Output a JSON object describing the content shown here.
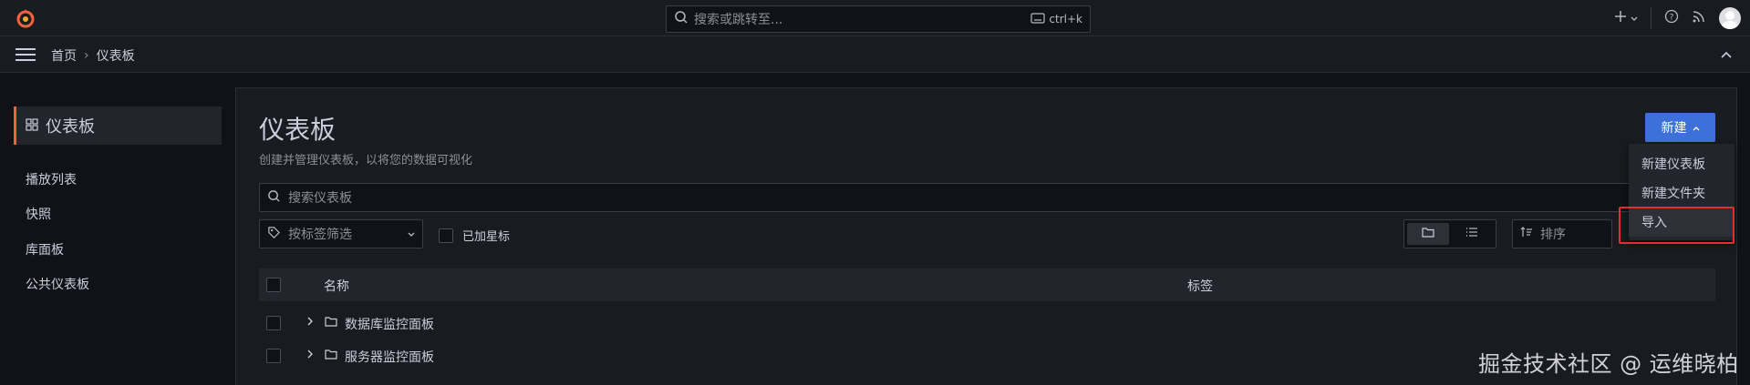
{
  "topbar": {
    "search_placeholder": "搜索或跳转至...",
    "shortcut": "ctrl+k",
    "add_icon": "plus-icon",
    "help_icon": "help-icon",
    "news_icon": "rss-icon"
  },
  "subbar": {
    "breadcrumb_home": "首页",
    "breadcrumb_sep": "›",
    "breadcrumb_current": "仪表板"
  },
  "sidebar": {
    "title": "仪表板",
    "items": [
      {
        "label": "播放列表"
      },
      {
        "label": "快照"
      },
      {
        "label": "库面板"
      },
      {
        "label": "公共仪表板"
      }
    ]
  },
  "main": {
    "title": "仪表板",
    "subtitle": "创建并管理仪表板，以将您的数据可视化",
    "new_button": "新建",
    "search_placeholder": "搜索仪表板",
    "tag_filter_placeholder": "按标签筛选",
    "starred_label": "已加星标",
    "sort_placeholder": "排序",
    "table": {
      "columns": [
        "名称",
        "标签"
      ],
      "rows": [
        {
          "name": "数据库监控面板"
        },
        {
          "name": "服务器监控面板"
        }
      ]
    }
  },
  "dropdown": {
    "items": [
      {
        "label": "新建仪表板"
      },
      {
        "label": "新建文件夹"
      },
      {
        "label": "导入"
      }
    ]
  },
  "watermark": "掘金技术社区 @ 运维晓柏",
  "colors": {
    "accent": "#3d71d9",
    "brand": "#f55f3e",
    "highlight": "#e02f2f"
  }
}
